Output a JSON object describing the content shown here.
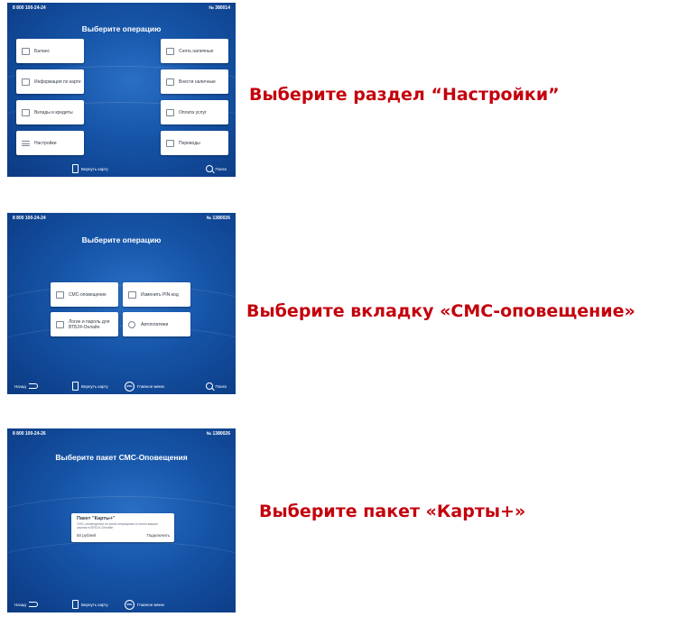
{
  "screen1": {
    "phone": "8 800 100-24-24",
    "atm_no": "№ 380014",
    "title": "Выберите операцию",
    "buttons": {
      "balance": "Баланс",
      "card_info": "Информация по карте",
      "deposits": "Вклады и кредиты",
      "settings": "Настройки",
      "withdraw": "Снять наличные",
      "deposit_cash": "Внести наличные",
      "payments": "Оплата услуг",
      "transfers": "Переводы"
    },
    "bottom": {
      "return_card": "Вернуть карту",
      "search": "Поиск"
    }
  },
  "screen2": {
    "phone": "8 800 100-24-24",
    "atm_no": "№ 1380026",
    "title": "Выберите операцию",
    "buttons": {
      "sms": "СМС-оповещение",
      "change_pin": "Изменить PIN-код",
      "login_password": "Логин и пароль для ВТБ24-Онлайн",
      "autopayments": "Автоплатежи"
    },
    "bottom": {
      "back": "Назад",
      "return_card": "Вернуть карту",
      "main_menu": "Главное меню",
      "search": "Поиск",
      "logo_text": "ВТБ"
    }
  },
  "screen3": {
    "phone": "8 800 100-24-26",
    "atm_no": "№ 1380026",
    "title": "Выберите пакет СМС-Оповещения",
    "package": {
      "name": "Пакет \"Карты+\"",
      "description": "СМС-оповещения по всем операциям по всем вашим картам в ВТБ24-Онлайн",
      "price": "50 рублей",
      "connect": "Подключить"
    },
    "bottom": {
      "back": "Назад",
      "return_card": "Вернуть карту",
      "main_menu": "Главное меню",
      "logo_text": "ВТБ"
    }
  },
  "instructions": {
    "step1": "Выберите раздел “Настройки”",
    "step2": "Выберите вкладку «СМС-оповещение»",
    "step3": "Выберите пакет «Карты+»"
  },
  "colors": {
    "instruction_text": "#c4000c",
    "screen_blue": "#1553a6",
    "button_bg": "#ffffff"
  }
}
